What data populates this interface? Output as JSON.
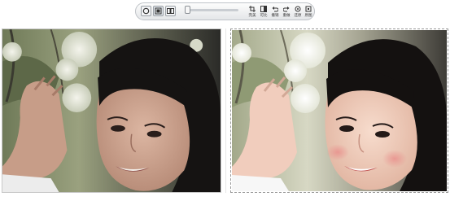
{
  "toolbar": {
    "view_modes": [
      {
        "icon": "single-view-icon",
        "selected": false
      },
      {
        "icon": "split-view-icon",
        "selected": true
      },
      {
        "icon": "side-by-side-view-icon",
        "selected": false
      }
    ],
    "zoom_slider": {
      "level": 0.0
    },
    "tools": [
      {
        "label": "完美",
        "icon": "crop-icon"
      },
      {
        "label": "可比",
        "icon": "compare-icon"
      },
      {
        "label": "撤销",
        "icon": "undo-icon"
      },
      {
        "label": "重做",
        "icon": "redo-icon"
      },
      {
        "label": "还原",
        "icon": "restore-icon"
      },
      {
        "label": "原图",
        "icon": "original-icon"
      }
    ]
  },
  "panels": {
    "before": {
      "icon": "photo-original-icon"
    },
    "after": {
      "icon": "photo-enhanced-icon"
    }
  }
}
